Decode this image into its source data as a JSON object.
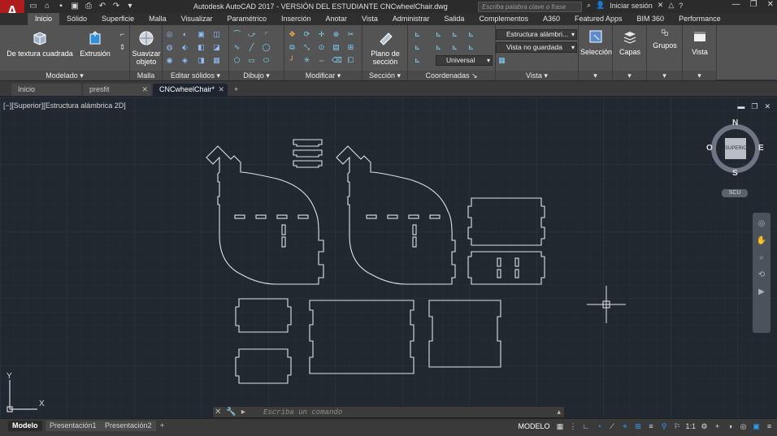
{
  "app": {
    "logo_letter": "A",
    "title": "Autodesk AutoCAD 2017 - VERSIÓN DEL ESTUDIANTE    CNCwheelChair.dwg",
    "search_placeholder": "Escriba palabra clave o frase",
    "signin": "Iniciar sesión",
    "help": "?"
  },
  "ribbon_tabs": [
    "Inicio",
    "Sólido",
    "Superficie",
    "Malla",
    "Visualizar",
    "Paramétrico",
    "Inserción",
    "Anotar",
    "Vista",
    "Administrar",
    "Salida",
    "Complementos",
    "A360",
    "Featured Apps",
    "BIM 360",
    "Performance"
  ],
  "ribbon": {
    "textura": "De textura cuadrada",
    "extrusion": "Extrusión",
    "suavizar": "Suavizar objeto",
    "plano": "Plano de sección",
    "seleccion": "Selección",
    "capas": "Capas",
    "grupos": "Grupos",
    "vista_btn": "Vista",
    "dd_estilo": "Estructura alámbri...",
    "dd_vista": "Vista no guardada",
    "dd_scu": "Universal",
    "panels": {
      "modelado": "Modelado",
      "malla": "Malla",
      "editar": "Editar sólidos",
      "dibujo": "Dibujo",
      "modificar": "Modificar",
      "seccion": "Sección",
      "coordenadas": "Coordenadas",
      "vista": "Vista"
    }
  },
  "doc_tabs": [
    "Inicio",
    "presfit",
    "CNCwheelChair*"
  ],
  "viewport": {
    "label": "[−][Superior][Estructura alámbrica 2D]",
    "viewcube": {
      "n": "N",
      "s": "S",
      "e": "E",
      "o": "O",
      "face": "SUPERIOR",
      "scu": "SCU"
    },
    "ucs_x": "X",
    "ucs_y": "Y"
  },
  "command": {
    "placeholder": "Escriba un comando"
  },
  "layout_tabs": [
    "Modelo",
    "Presentación1",
    "Presentación2"
  ],
  "status": {
    "modelo": "MODELO",
    "scale": "1:1"
  },
  "colors": {
    "canvas": "#212830",
    "grid_major": "#2d3744",
    "grid_minor": "#262e3a",
    "line": "#dfe3e8",
    "accent": "#2aa3ff",
    "logo": "#b01c1c"
  }
}
